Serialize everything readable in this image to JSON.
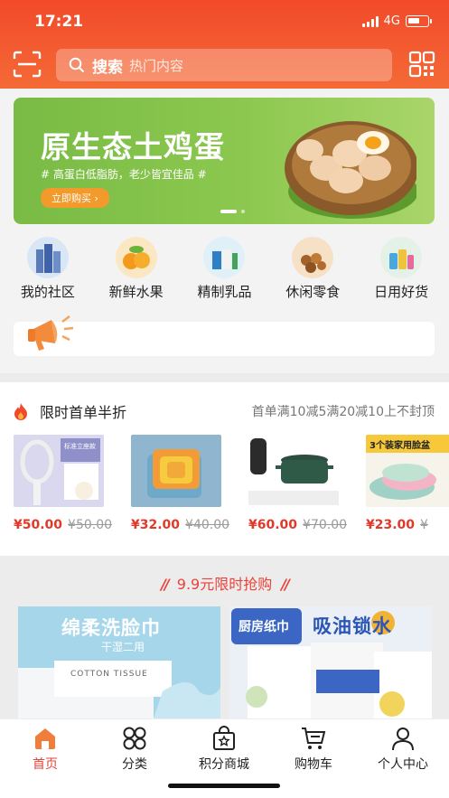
{
  "status_bar": {
    "time": "17:21",
    "network": "4G"
  },
  "header": {
    "search_label": "搜索",
    "search_placeholder": "热门内容"
  },
  "banner": {
    "title": "原生态土鸡蛋",
    "subtitle": "# 高蛋白低脂肪，老少皆宜佳品 #",
    "button": "立即购买 ›",
    "pages": 2,
    "current_page": 1
  },
  "categories": [
    {
      "label": "我的社区",
      "icon": "community-icon"
    },
    {
      "label": "新鲜水果",
      "icon": "fruit-icon"
    },
    {
      "label": "精制乳品",
      "icon": "dairy-icon"
    },
    {
      "label": "休闲零食",
      "icon": "snack-icon"
    },
    {
      "label": "日用好货",
      "icon": "daily-goods-icon"
    }
  ],
  "flash_sale": {
    "title": "限时首单半折",
    "promo": "首单满10减5满20减10上不封顶",
    "items": [
      {
        "price": "¥50.00",
        "original": "¥50.00",
        "img_text": "标准立座款"
      },
      {
        "price": "¥32.00",
        "original": "¥40.00",
        "img_text": ""
      },
      {
        "price": "¥60.00",
        "original": "¥70.00",
        "img_text": ""
      },
      {
        "price": "¥23.00",
        "original": "¥",
        "img_text": "3个装家用脸盆"
      }
    ]
  },
  "sale_99": {
    "title": "9.9元限时抢购",
    "product_a_title": "绵柔洗脸巾",
    "product_a_sub": "干湿二用",
    "product_a_pack": "COTTON TISSUE",
    "product_b_title": "吸油锁水",
    "product_b_label": "厨房纸巾"
  },
  "tabbar": [
    {
      "label": "首页",
      "icon": "home-icon",
      "active": true
    },
    {
      "label": "分类",
      "icon": "category-icon",
      "active": false
    },
    {
      "label": "积分商城",
      "icon": "points-mall-icon",
      "active": false
    },
    {
      "label": "购物车",
      "icon": "cart-icon",
      "active": false
    },
    {
      "label": "个人中心",
      "icon": "profile-icon",
      "active": false
    }
  ],
  "colors": {
    "brand": "#f24a2a",
    "price": "#e0392a",
    "banner_green": "#7fbf47"
  }
}
